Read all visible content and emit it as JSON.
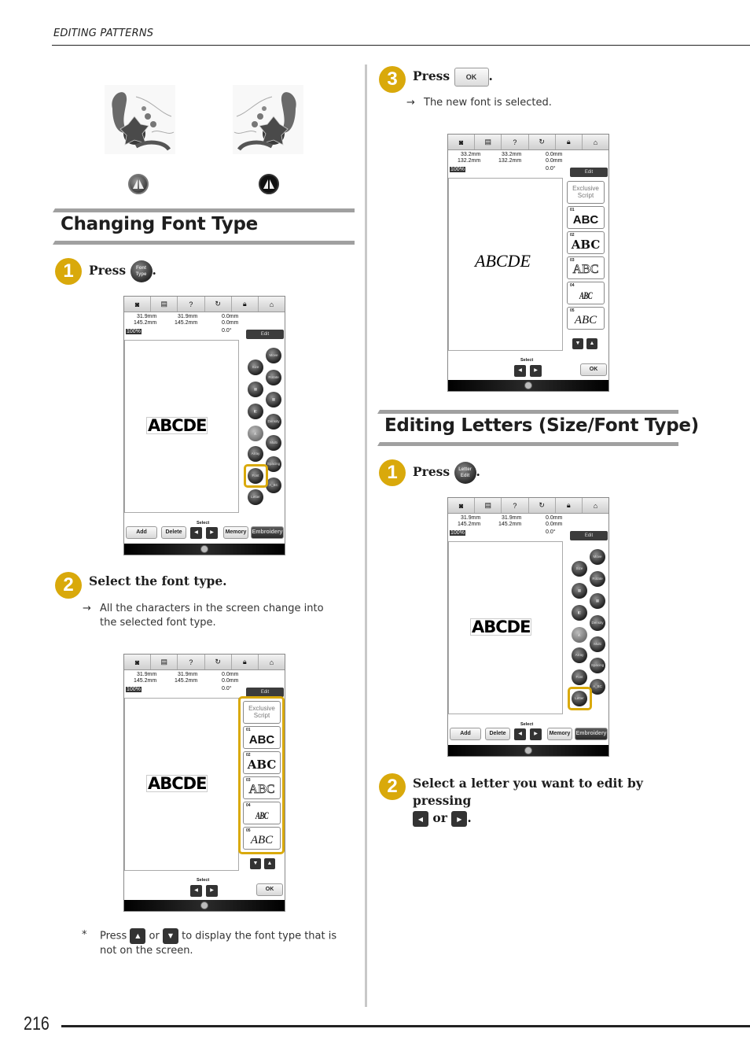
{
  "header": {
    "running_head": "EDITING PATTERNS"
  },
  "footer": {
    "page_number": "216"
  },
  "icons": {
    "mirror_off": "mirror-horizontal-icon",
    "mirror_on": "mirror-horizontal-active-icon"
  },
  "section1": {
    "title": "Changing Font Type",
    "step1": {
      "number": "1",
      "prefix": "Press",
      "button_label_line1": "Font",
      "button_label_line2": "Type",
      "suffix": "."
    },
    "step2": {
      "number": "2",
      "title": "Select the font type.",
      "result": "All the characters in the screen change into the selected font type."
    },
    "note": {
      "marker": "*",
      "prefix": "Press",
      "or": "or",
      "suffix": "to display the font type that is not on the screen."
    }
  },
  "section1b": {
    "step3": {
      "number": "3",
      "prefix": "Press",
      "ok_label": "OK",
      "suffix": ".",
      "result": "The new font is selected."
    }
  },
  "section2": {
    "title": "Editing Letters (Size/Font Type)",
    "step1": {
      "number": "1",
      "prefix": "Press",
      "button_label_line1": "Letter",
      "button_label_line2": "Edit",
      "suffix": "."
    },
    "step2": {
      "number": "2",
      "line1": "Select a letter you want to edit by pressing",
      "or": "or",
      "suffix": "."
    }
  },
  "arrow_symbol": "→",
  "screen_common": {
    "topbar": [
      "◘",
      "▤",
      "?",
      "↺",
      "🔒",
      "⌂"
    ],
    "select_label": "Select",
    "edit_label": "Edit",
    "add": "Add",
    "delete": "Delete",
    "memory": "Memory",
    "embroidery": "Embroidery",
    "ok": "OK",
    "zoom_level": "100%",
    "rotation": "0.0°",
    "offset_v": "0.0mm",
    "offset_h": "0.0mm"
  },
  "screen_a": {
    "w1": "31.9mm",
    "h1": "145.2mm",
    "w2": "31.9mm",
    "h2": "145.2mm",
    "text": "ABCDE"
  },
  "screen_b": {
    "w1": "31.9mm",
    "h1": "145.2mm",
    "w2": "31.9mm",
    "h2": "145.2mm",
    "text": "ABCDE"
  },
  "screen_c": {
    "w1": "33.2mm",
    "h1": "132.2mm",
    "w2": "33.2mm",
    "h2": "132.2mm",
    "text": "ABCDE"
  },
  "screen_d": {
    "w1": "31.9mm",
    "h1": "145.2mm",
    "w2": "31.9mm",
    "h2": "145.2mm",
    "text": "ABCDE"
  },
  "edit_buttons": [
    "Move",
    "Size",
    "Rotate",
    "Group",
    "Array",
    "Order",
    "Density",
    "Mirror",
    "Multi Color",
    "Arc",
    "Spacing",
    "Font Type",
    "A-BC",
    "Letter Edit"
  ],
  "font_list": [
    {
      "num": "",
      "line1": "Exclusive",
      "line2": "Script"
    },
    {
      "num": "01",
      "sample": "ABC"
    },
    {
      "num": "02",
      "sample": "ABC"
    },
    {
      "num": "03",
      "sample": "ABC"
    },
    {
      "num": "04",
      "sample": "ABC"
    },
    {
      "num": "05",
      "sample": "ABC"
    }
  ],
  "accent_color": "#d9a90b"
}
